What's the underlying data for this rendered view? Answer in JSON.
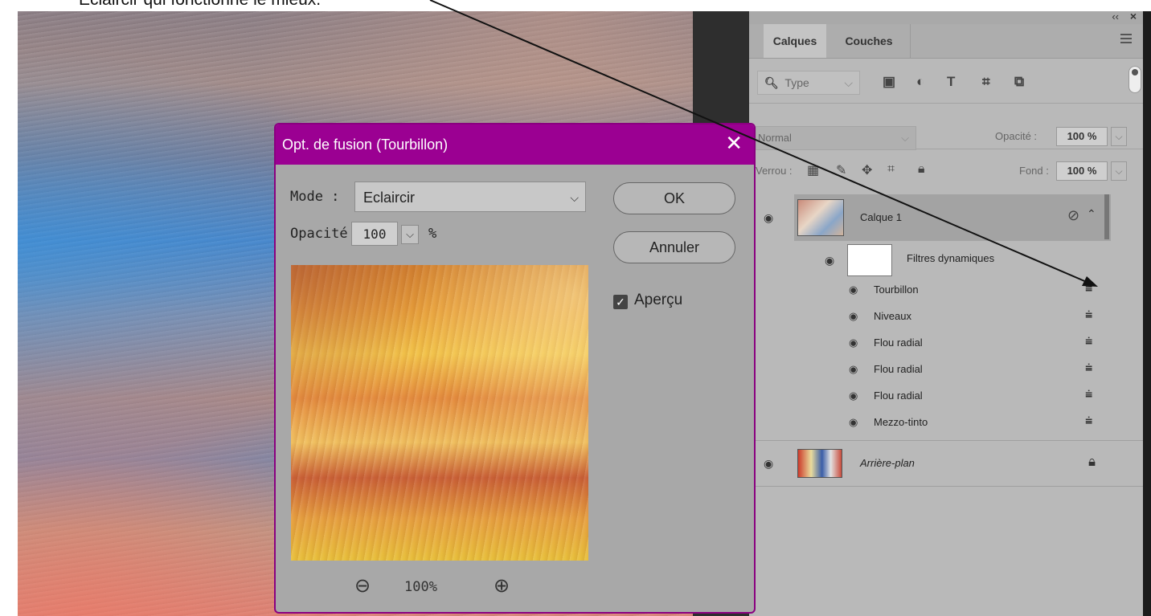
{
  "caption": "Eclaircir qui fonctionne le mieux.",
  "dialog": {
    "title": "Opt. de fusion (Tourbillon)",
    "mode_label": "Mode :",
    "mode_value": "Eclaircir",
    "opacity_label": "Opacité :",
    "opacity_value": "100",
    "opacity_unit": "%",
    "ok_label": "OK",
    "cancel_label": "Annuler",
    "preview_label": "Aperçu",
    "preview_checked": true,
    "zoom_value": "100%"
  },
  "panel": {
    "tabs": [
      "Calques",
      "Couches"
    ],
    "filter_placeholder": "Type",
    "blend_mode": "Normal",
    "opacity_label": "Opacité :",
    "opacity_value": "100 %",
    "lock_label": "Verrou :",
    "fill_label": "Fond :",
    "fill_value": "100 %",
    "layers": {
      "layer1": "Calque 1",
      "smart_filters": "Filtres dynamiques",
      "filters": [
        "Tourbillon",
        "Niveaux",
        "Flou radial",
        "Flou radial",
        "Flou radial",
        "Mezzo-tinto"
      ],
      "background": "Arrière-plan"
    }
  },
  "icons": [
    "search-icon",
    "image-filter-icon",
    "adjustment-filter-icon",
    "type-filter-icon",
    "shape-filter-icon",
    "smart-object-filter-icon",
    "eye-icon",
    "lock-icon",
    "blend-options-icon",
    "zoom-in-icon",
    "zoom-out-icon",
    "close-icon",
    "menu-icon"
  ],
  "colors": {
    "dialog_accent": "#9b0092",
    "panel_bg": "#b9b9b9"
  }
}
